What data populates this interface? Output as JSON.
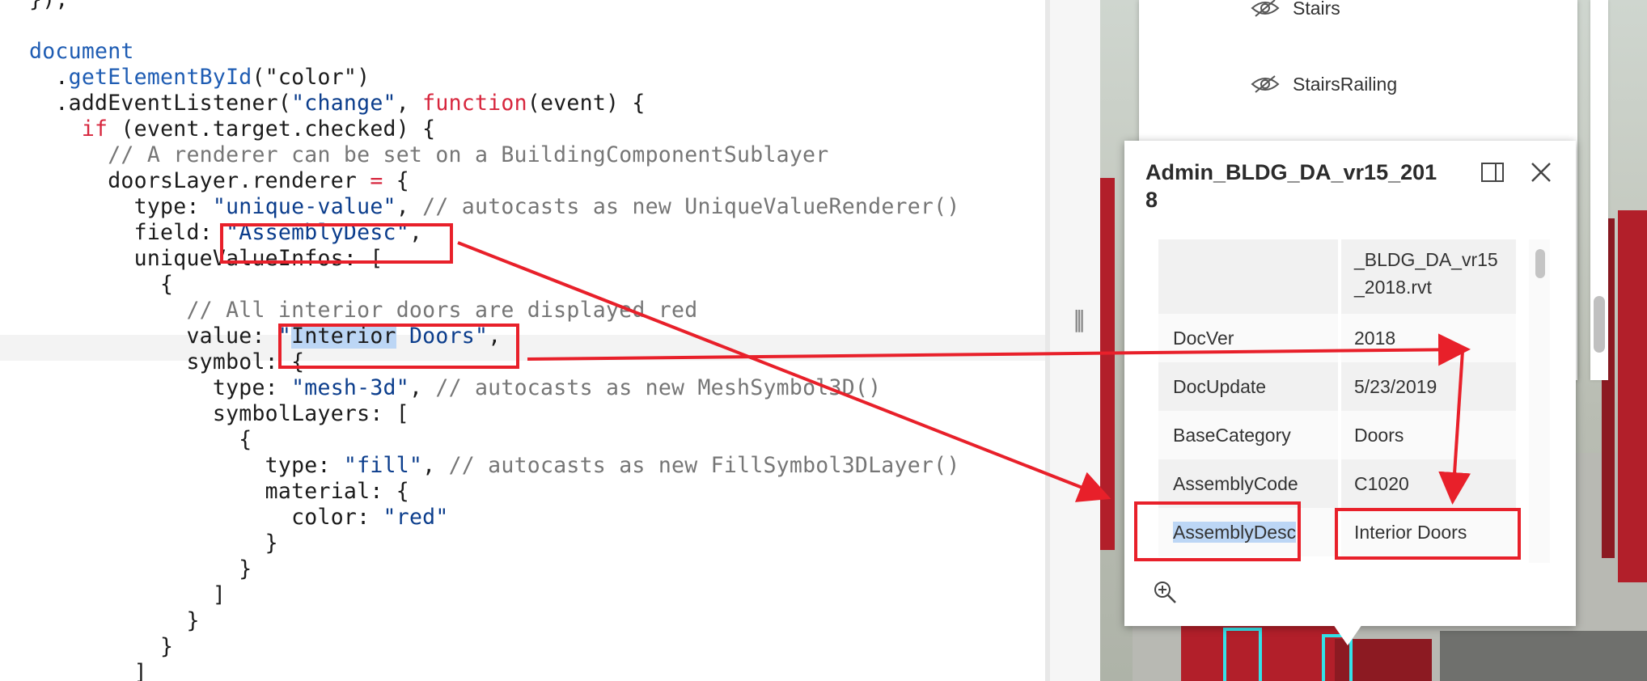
{
  "code": {
    "lines": [
      [
        {
          "t": "});",
          "c": "plain"
        }
      ],
      [
        {
          "t": "",
          "c": "plain"
        }
      ],
      [
        {
          "t": "document",
          "c": "blue"
        }
      ],
      [
        {
          "t": "  .",
          "c": "plain"
        },
        {
          "t": "getElementById",
          "c": "blue"
        },
        {
          "t": "(\"color\")",
          "c": "plain"
        }
      ],
      [
        {
          "t": "  .addEventListener(",
          "c": "plain"
        },
        {
          "t": "\"change\"",
          "c": "str"
        },
        {
          "t": ", ",
          "c": "plain"
        },
        {
          "t": "function",
          "c": "kw"
        },
        {
          "t": "(event) {",
          "c": "plain"
        }
      ],
      [
        {
          "t": "    ",
          "c": "plain"
        },
        {
          "t": "if",
          "c": "kw"
        },
        {
          "t": " (event.target.checked) {",
          "c": "plain"
        }
      ],
      [
        {
          "t": "      // A renderer can be set on a BuildingComponentSublayer",
          "c": "cmt"
        }
      ],
      [
        {
          "t": "      doorsLayer.renderer ",
          "c": "plain"
        },
        {
          "t": "=",
          "c": "kw"
        },
        {
          "t": " {",
          "c": "plain"
        }
      ],
      [
        {
          "t": "        type: ",
          "c": "plain"
        },
        {
          "t": "\"unique-value\"",
          "c": "str"
        },
        {
          "t": ", ",
          "c": "plain"
        },
        {
          "t": "// autocasts as new UniqueValueRenderer()",
          "c": "cmt"
        }
      ],
      [
        {
          "t": "        field: ",
          "c": "plain"
        },
        {
          "t": "\"AssemblyDesc\"",
          "c": "str"
        },
        {
          "t": ",",
          "c": "plain"
        }
      ],
      [
        {
          "t": "        uniqueValueInfos: [",
          "c": "plain"
        }
      ],
      [
        {
          "t": "          {",
          "c": "plain"
        }
      ],
      [
        {
          "t": "            // All interior doors are displayed red",
          "c": "cmt"
        }
      ],
      [
        {
          "t": "            value: ",
          "c": "plain"
        },
        {
          "t": "\"",
          "c": "str"
        },
        {
          "t": "Interior",
          "c": "sel"
        },
        {
          "t": " Doors\"",
          "c": "str"
        },
        {
          "t": ",",
          "c": "plain"
        }
      ],
      [
        {
          "t": "            symbol: {",
          "c": "plain"
        }
      ],
      [
        {
          "t": "              type: ",
          "c": "plain"
        },
        {
          "t": "\"mesh-3d\"",
          "c": "str"
        },
        {
          "t": ", ",
          "c": "plain"
        },
        {
          "t": "// autocasts as new MeshSymbol3D()",
          "c": "cmt"
        }
      ],
      [
        {
          "t": "              symbolLayers: [",
          "c": "plain"
        }
      ],
      [
        {
          "t": "                {",
          "c": "plain"
        }
      ],
      [
        {
          "t": "                  type: ",
          "c": "plain"
        },
        {
          "t": "\"fill\"",
          "c": "str"
        },
        {
          "t": ", ",
          "c": "plain"
        },
        {
          "t": "// autocasts as new FillSymbol3DLayer()",
          "c": "cmt"
        }
      ],
      [
        {
          "t": "                  material: {",
          "c": "plain"
        }
      ],
      [
        {
          "t": "                    color: ",
          "c": "plain"
        },
        {
          "t": "\"red\"",
          "c": "str"
        }
      ],
      [
        {
          "t": "                  }",
          "c": "plain"
        }
      ],
      [
        {
          "t": "                }",
          "c": "plain"
        }
      ],
      [
        {
          "t": "              ]",
          "c": "plain"
        }
      ],
      [
        {
          "t": "            }",
          "c": "plain"
        }
      ],
      [
        {
          "t": "          }",
          "c": "plain"
        }
      ],
      [
        {
          "t": "        ]",
          "c": "plain"
        }
      ]
    ]
  },
  "layer_list": {
    "items": [
      {
        "label": "Stairs",
        "icon": "eye-slash-icon"
      },
      {
        "label": "StairsRailing",
        "icon": "eye-slash-icon"
      }
    ]
  },
  "popup": {
    "title": "Admin_BLDG_DA_vr15_2018",
    "dock_icon": "dock-side-icon",
    "close_icon": "close-icon",
    "zoom_icon": "zoom-in-icon",
    "first_value_lines": [
      "_BLDG_DA_vr15",
      "_2018.rvt"
    ],
    "attributes": [
      {
        "key": "DocVer",
        "value": "2018"
      },
      {
        "key": "DocUpdate",
        "value": "5/23/2019"
      },
      {
        "key": "BaseCategory",
        "value": "Doors"
      },
      {
        "key": "AssemblyCode",
        "value": "C1020"
      },
      {
        "key": "AssemblyDesc",
        "value": "Interior Doors"
      }
    ]
  },
  "colors": {
    "annotation_red": "#e8202a",
    "selection_blue": "#bcd6f5",
    "keyword_red": "#d7263d",
    "string_navy": "#0b3d8c",
    "identifier_blue": "#1e5cb3",
    "wall_red": "#b21f2a",
    "highlight_cyan": "#34e2e8"
  }
}
